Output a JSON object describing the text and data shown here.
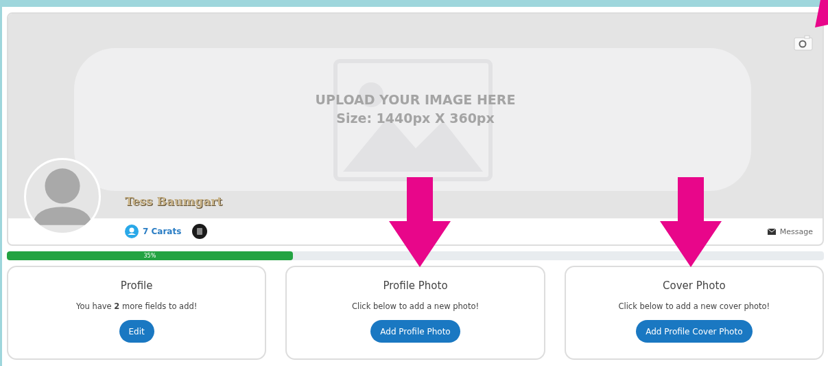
{
  "cover": {
    "upload_title": "UPLOAD YOUR IMAGE HERE",
    "upload_size": "Size: 1440px X 360px",
    "name": "Tess Baumgart",
    "carats": "7 Carats",
    "message": "Message"
  },
  "progress": {
    "level": 0.35,
    "label": "35%"
  },
  "cards": [
    {
      "title": "Profile",
      "text": "You have **2** more fields to add!",
      "button": "Edit"
    },
    {
      "title": "Profile Photo",
      "text": "Click below to add a new photo!",
      "button": "Add Profile Photo"
    },
    {
      "title": "Cover Photo",
      "text": "Click below to add a new cover photo!",
      "button": "Add Profile Cover Photo"
    }
  ]
}
